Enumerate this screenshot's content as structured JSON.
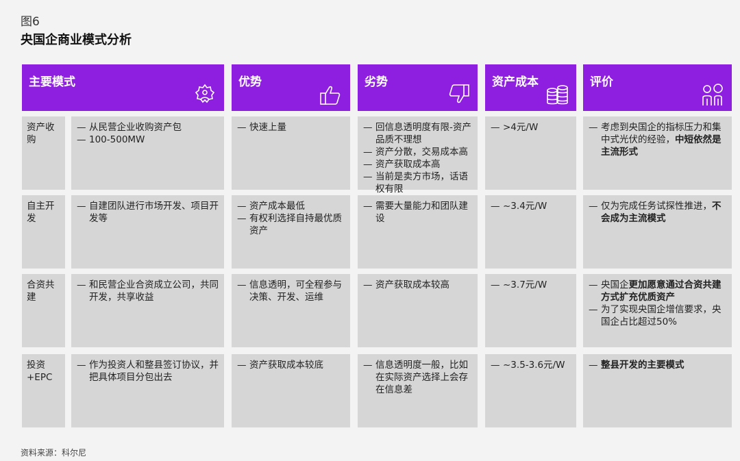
{
  "figure": {
    "label": "图6",
    "title": "央国企商业模式分析",
    "source": "资料来源：科尔尼"
  },
  "headers": [
    {
      "label": "主要模式",
      "icon": "gear-person-icon"
    },
    {
      "label": "优势",
      "icon": "thumbs-up-icon"
    },
    {
      "label": "劣势",
      "icon": "thumbs-down-icon"
    },
    {
      "label": "资产成本",
      "icon": "coins-icon"
    },
    {
      "label": "评价",
      "icon": "people-icon"
    }
  ],
  "colors": {
    "header_bg": "#8f1fe0",
    "cell_bg": "#d6d6d6",
    "page_bg": "#f3f3f3"
  },
  "rows": [
    {
      "mode": "资产收购",
      "description": [
        "从民营企业收购资产包",
        "100-500MW"
      ],
      "advantages": [
        "快速上量"
      ],
      "disadvantages": [
        "回信息透明度有限-资产品质不理想",
        "资产分散，交易成本高",
        "资产获取成本高",
        "当前是卖方市场，话语权有限"
      ],
      "cost": [
        "&gt;4元/W"
      ],
      "evaluation": [
        "考虑到央国企的指标压力和集中式光伏的经验，<b>中短依然是主流形式</b>"
      ]
    },
    {
      "mode": "自主开发",
      "description": [
        "自建团队进行市场开发、项目开发等"
      ],
      "advantages": [
        "资产成本最低",
        "有权利选择自持最优质资产"
      ],
      "disadvantages": [
        "需要大量能力和团队建设"
      ],
      "cost": [
        "~3.4元/W"
      ],
      "evaluation": [
        "仅为完成任务试探性推进，<b>不会成为主流模式</b>"
      ]
    },
    {
      "mode": "合资共建",
      "description": [
        "和民营企业合资成立公司，共同开发，共享收益"
      ],
      "advantages": [
        "信息透明，可全程参与决策、开发、运维"
      ],
      "disadvantages": [
        "资产获取成本较高"
      ],
      "cost": [
        "~3.7元/W"
      ],
      "evaluation": [
        "央国企<b>更加愿意通过合资共建方式扩充优质资产</b>",
        "为了实现央国企增信要求，央国企占比超过50%"
      ]
    },
    {
      "mode": "投资+EPC",
      "description": [
        "作为投资人和整县签订协议，并把具体项目分包出去"
      ],
      "advantages": [
        "资产获取成本较底"
      ],
      "disadvantages": [
        "信息透明度一般，比如在实际资产选择上会存在信息差"
      ],
      "cost": [
        "~3.5-3.6元/W"
      ],
      "evaluation": [
        "<b>整县开发的主要模式</b>"
      ]
    }
  ]
}
